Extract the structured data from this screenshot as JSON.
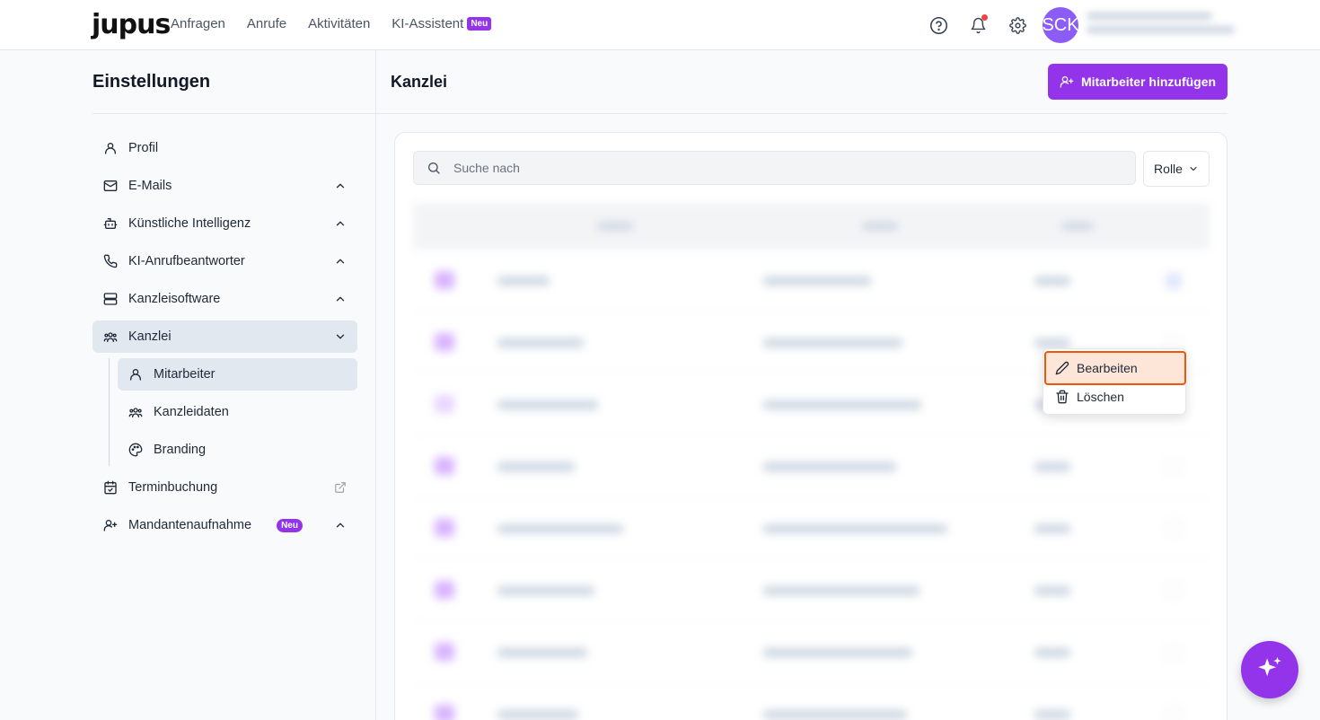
{
  "brand": {
    "logo": "jupus",
    "accent": "#9333ea"
  },
  "nav": {
    "items": [
      "Anfragen",
      "Anrufe",
      "Aktivitäten",
      "KI-Assistent"
    ],
    "ki_badge": "Neu"
  },
  "header_icons": [
    "help-circle-icon",
    "bell-icon",
    "gear-icon"
  ],
  "user": {
    "initials": "SCK"
  },
  "settings": {
    "title": "Einstellungen",
    "items": [
      {
        "label": "Profil",
        "icon": "user-icon"
      },
      {
        "label": "E-Mails",
        "icon": "mail-icon"
      },
      {
        "label": "Künstliche Intelligenz",
        "icon": "bot-icon"
      },
      {
        "label": "KI-Anrufbeantworter",
        "icon": "phone-icon"
      },
      {
        "label": "Kanzleisoftware",
        "icon": "server-icon"
      },
      {
        "label": "Kanzlei",
        "icon": "users-icon"
      },
      {
        "label": "Terminbuchung",
        "icon": "calendar-check-icon"
      },
      {
        "label": "Mandantenaufnahme",
        "icon": "user-plus-icon",
        "badge": "Neu"
      }
    ],
    "sub_items": [
      {
        "label": "Mitarbeiter",
        "icon": "user-icon"
      },
      {
        "label": "Kanzleidaten",
        "icon": "users-icon"
      },
      {
        "label": "Branding",
        "icon": "palette-icon"
      }
    ]
  },
  "main": {
    "title": "Kanzlei",
    "add_button": "Mitarbeiter hinzufügen",
    "search_placeholder": "Suche nach",
    "role_filter": "Rolle"
  },
  "context_menu": {
    "edit": "Bearbeiten",
    "delete": "Löschen"
  }
}
